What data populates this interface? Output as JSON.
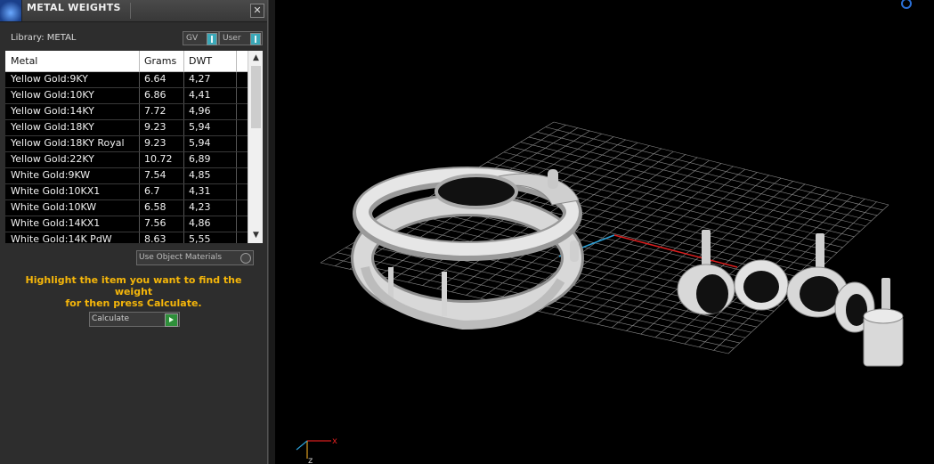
{
  "panel": {
    "title": "METAL WEIGHTS",
    "close_glyph": "✕",
    "library_label": "Library:",
    "library_value": "METAL",
    "toggle_gv": "GV",
    "toggle_user": "User",
    "table": {
      "headers": [
        "Metal",
        "Grams",
        "DWT"
      ],
      "rows": [
        [
          "Yellow Gold:9KY",
          "6.64",
          "4,27"
        ],
        [
          "Yellow Gold:10KY",
          "6.86",
          "4,41"
        ],
        [
          "Yellow Gold:14KY",
          "7.72",
          "4,96"
        ],
        [
          "Yellow Gold:18KY",
          "9.23",
          "5,94"
        ],
        [
          "Yellow Gold:18KY Royal",
          "9.23",
          "5,94"
        ],
        [
          "Yellow Gold:22KY",
          "10.72",
          "6,89"
        ],
        [
          "White Gold:9KW",
          "7.54",
          "4,85"
        ],
        [
          "White Gold:10KX1",
          "6.7",
          "4,31"
        ],
        [
          "White Gold:10KW",
          "6.58",
          "4,23"
        ],
        [
          "White Gold:14KX1",
          "7.56",
          "4,86"
        ],
        [
          "White Gold:14K PdW",
          "8.63",
          "5,55"
        ]
      ]
    },
    "use_object_materials": "Use Object Materials",
    "hint_line1": "Highlight the item you want to find the weight",
    "hint_line2": "for then press Calculate.",
    "calculate_label": "Calculate"
  },
  "viewport": {
    "axis_x": "x",
    "axis_z": "z",
    "colors": {
      "grid": "#8a8a8a",
      "x_axis": "#d81e1e",
      "y_axis": "#2a9fd6",
      "model": "#d9d9d9"
    }
  }
}
